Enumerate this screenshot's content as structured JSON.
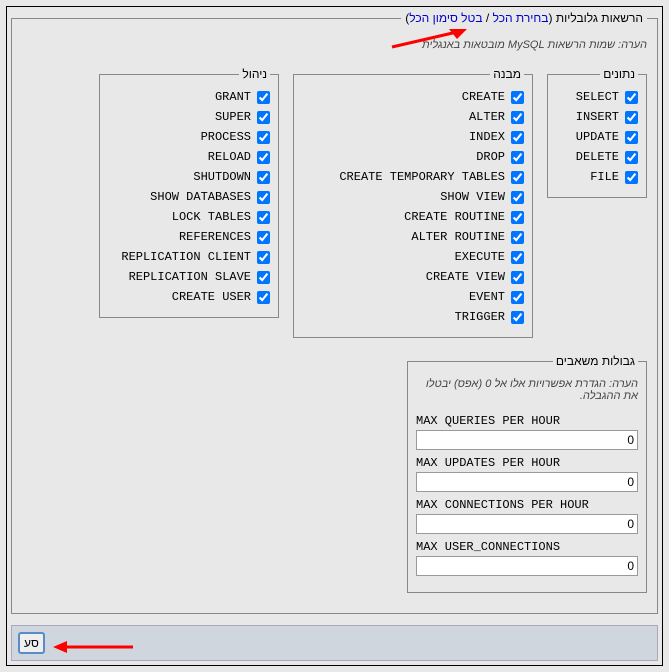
{
  "main": {
    "legend_prefix": "הרשאות גלובליות (",
    "select_all": "בחירת הכל",
    "sep": " / ",
    "deselect_all": "בטל סימון הכל",
    "legend_suffix": ")",
    "note": "הערה: שמות הרשאות MySQL מובטאות באנגלית"
  },
  "groups": {
    "data": {
      "legend": "נתונים",
      "items": [
        {
          "label": "SELECT",
          "checked": true
        },
        {
          "label": "INSERT",
          "checked": true
        },
        {
          "label": "UPDATE",
          "checked": true
        },
        {
          "label": "DELETE",
          "checked": true
        },
        {
          "label": "FILE",
          "checked": true
        }
      ]
    },
    "structure": {
      "legend": "מבנה",
      "items": [
        {
          "label": "CREATE",
          "checked": true
        },
        {
          "label": "ALTER",
          "checked": true
        },
        {
          "label": "INDEX",
          "checked": true
        },
        {
          "label": "DROP",
          "checked": true
        },
        {
          "label": "CREATE TEMPORARY TABLES",
          "checked": true
        },
        {
          "label": "SHOW VIEW",
          "checked": true
        },
        {
          "label": "CREATE ROUTINE",
          "checked": true
        },
        {
          "label": "ALTER ROUTINE",
          "checked": true
        },
        {
          "label": "EXECUTE",
          "checked": true
        },
        {
          "label": "CREATE VIEW",
          "checked": true
        },
        {
          "label": "EVENT",
          "checked": true
        },
        {
          "label": "TRIGGER",
          "checked": true
        }
      ]
    },
    "admin": {
      "legend": "ניהול",
      "items": [
        {
          "label": "GRANT",
          "checked": true
        },
        {
          "label": "SUPER",
          "checked": true
        },
        {
          "label": "PROCESS",
          "checked": true
        },
        {
          "label": "RELOAD",
          "checked": true
        },
        {
          "label": "SHUTDOWN",
          "checked": true
        },
        {
          "label": "SHOW DATABASES",
          "checked": true
        },
        {
          "label": "LOCK TABLES",
          "checked": true
        },
        {
          "label": "REFERENCES",
          "checked": true
        },
        {
          "label": "REPLICATION CLIENT",
          "checked": true
        },
        {
          "label": "REPLICATION SLAVE",
          "checked": true
        },
        {
          "label": "CREATE USER",
          "checked": true
        }
      ]
    },
    "limits": {
      "legend": "גבולות משאבים",
      "note": "הערה: הגדרת אפשרויות אלו אל 0 (אפס) יבטלו את ההגבלה.",
      "items": [
        {
          "label": "MAX QUERIES PER HOUR",
          "value": "0"
        },
        {
          "label": "MAX UPDATES PER HOUR",
          "value": "0"
        },
        {
          "label": "MAX CONNECTIONS PER HOUR",
          "value": "0"
        },
        {
          "label": "MAX USER_CONNECTIONS",
          "value": "0"
        }
      ]
    }
  },
  "bottom": {
    "submit": "סע"
  }
}
